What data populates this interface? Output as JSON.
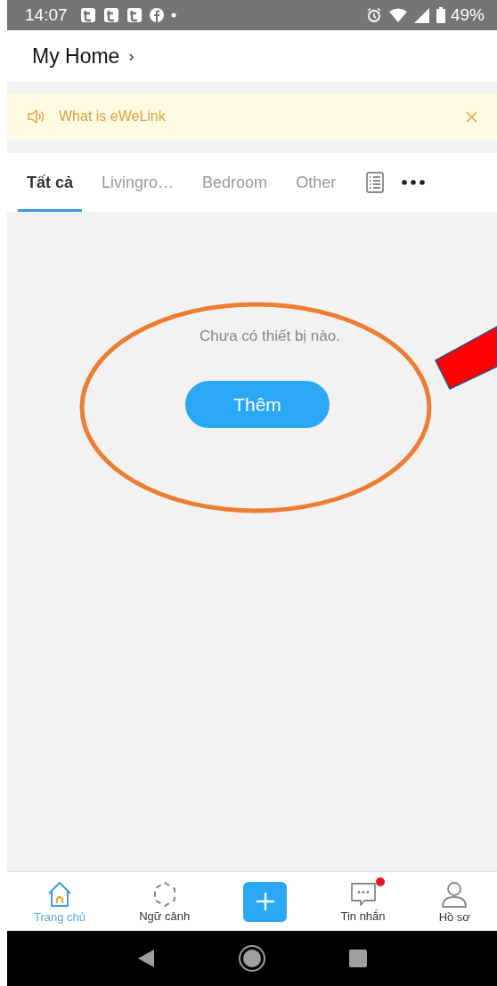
{
  "status_bar": {
    "time": "14:07",
    "battery": "49%"
  },
  "header": {
    "title": "My Home",
    "chevron": "›"
  },
  "banner": {
    "text": "What is eWeLink"
  },
  "tabs": [
    {
      "label": "Tất cả",
      "selected": true
    },
    {
      "label": "Livingro…",
      "selected": false
    },
    {
      "label": "Bedroom",
      "selected": false
    },
    {
      "label": "Other",
      "selected": false
    }
  ],
  "empty_state": {
    "message": "Chưa có thiết bị nào.",
    "button": "Thêm"
  },
  "bottom_nav": [
    {
      "kind": "home",
      "label": "Trang chủ",
      "selected": true,
      "badge": false
    },
    {
      "kind": "scene",
      "label": "Ngữ cảnh",
      "selected": false,
      "badge": false
    },
    {
      "kind": "add",
      "selected": false,
      "badge": false
    },
    {
      "kind": "messages",
      "label": "Tin nhắn",
      "selected": false,
      "badge": true
    },
    {
      "kind": "profile",
      "label": "Hồ sơ",
      "selected": false,
      "badge": false
    }
  ]
}
